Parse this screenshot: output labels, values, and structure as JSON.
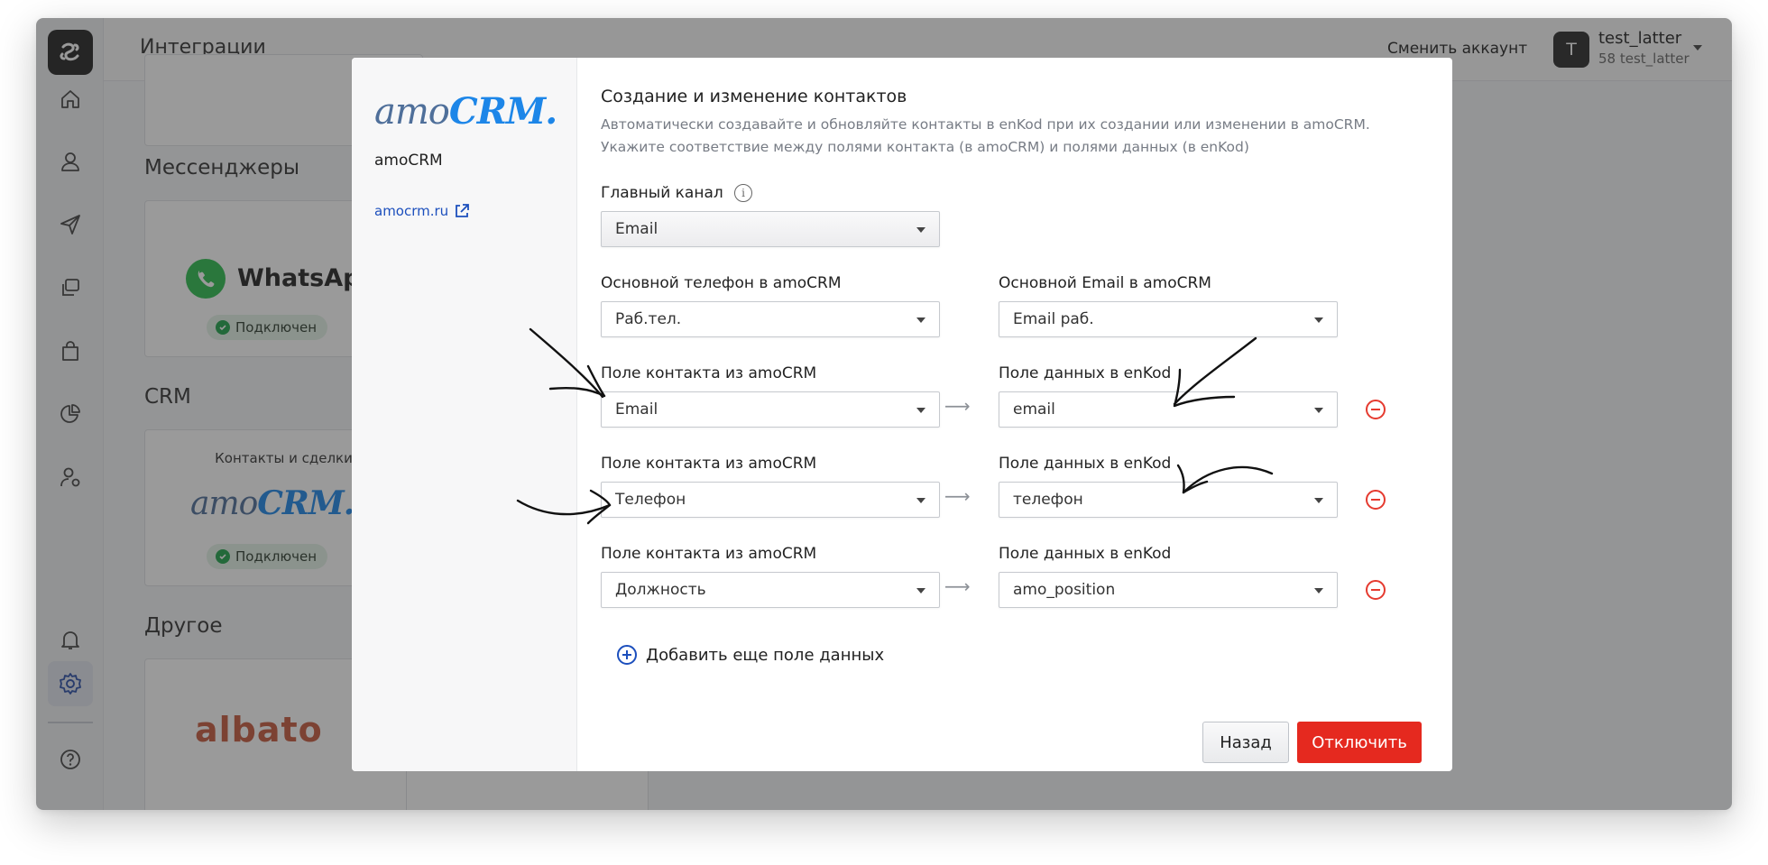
{
  "header": {
    "title": "Интеграции",
    "switch_account": "Сменить аккаунт",
    "user": {
      "initial": "T",
      "name": "test_latter",
      "sub": "58 test_latter"
    }
  },
  "sections": {
    "messengers": "Мессенджеры",
    "crm": "CRM",
    "other": "Другое"
  },
  "cards": {
    "whatsapp": {
      "name": "WhatsApp",
      "status": "Подключен"
    },
    "amocrm": {
      "subtitle": "Контакты и сделки",
      "logo_a": "amo",
      "logo_b": "CRM.",
      "status": "Подключен"
    },
    "albato": {
      "name": "albato"
    }
  },
  "modal": {
    "vendor_logo_a": "amo",
    "vendor_logo_b": "CRM.",
    "vendor_name": "amoCRM",
    "vendor_link": "amocrm.ru",
    "title": "Создание и изменение контактов",
    "description": "Автоматически создавайте и обновляйте контакты в enKod при их создании или изменении в amoCRM. Укажите соответствие между полями контакта (в amoCRM) и полями данных (в enKod)",
    "main_channel": {
      "label": "Главный канал",
      "value": "Email"
    },
    "main_phone": {
      "label": "Основной телефон в amoCRM",
      "value": "Раб.тел."
    },
    "main_email": {
      "label": "Основной Email в amoCRM",
      "value": "Email раб."
    },
    "mappings": [
      {
        "left_label": "Поле контакта из amoCRM",
        "left_value": "Email",
        "right_label": "Поле данных в enKod",
        "right_value": "email"
      },
      {
        "left_label": "Поле контакта из amoCRM",
        "left_value": "Телефон",
        "right_label": "Поле данных в enKod",
        "right_value": "телефон"
      },
      {
        "left_label": "Поле контакта из amoCRM",
        "left_value": "Должность",
        "right_label": "Поле данных в enKod",
        "right_value": "amo_position"
      }
    ],
    "add_field": "Добавить еще поле данных",
    "back_button": "Назад",
    "disconnect_button": "Отключить"
  },
  "colors": {
    "accent_blue": "#1c4fbd",
    "danger_red": "#e5291f",
    "success_green": "#1fa34a",
    "amo_blue": "#1d86e8"
  }
}
